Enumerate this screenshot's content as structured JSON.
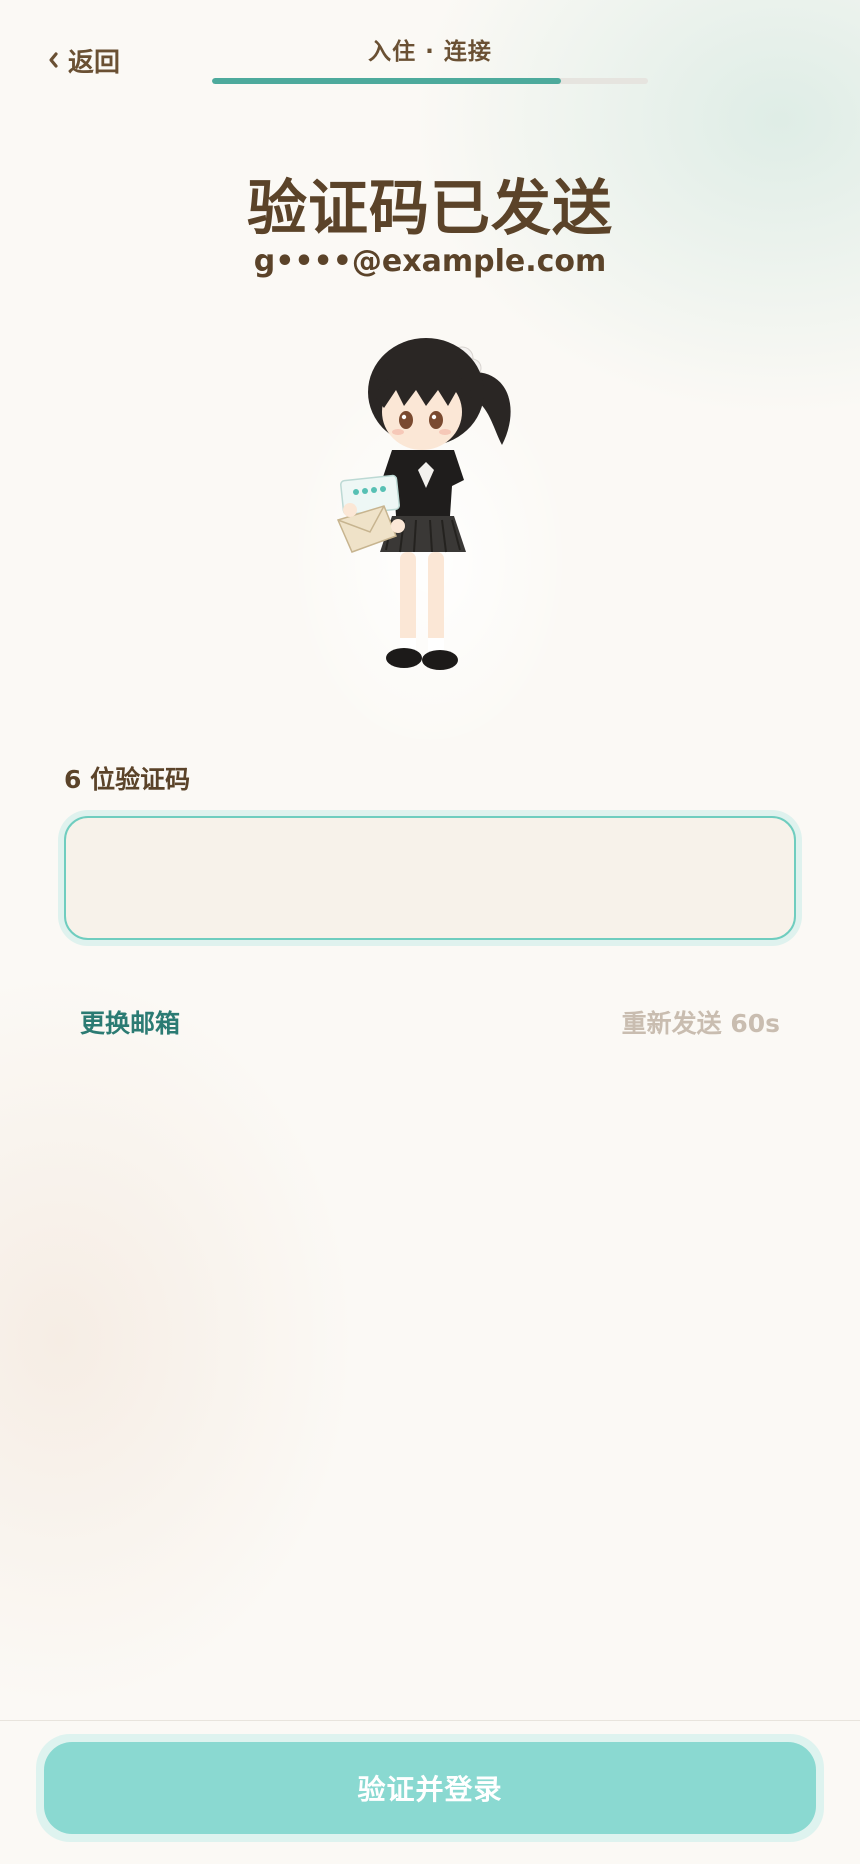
{
  "header": {
    "back_label": "返回",
    "step_title": "入住 · 连接",
    "progress_fraction": 0.8
  },
  "headline": "验证码已发送",
  "email": "g••••@example.com",
  "code_field": {
    "label": "6 位验证码",
    "value": "",
    "placeholder": ""
  },
  "actions": {
    "change_email": "更换邮箱",
    "resend": "重新发送 60s"
  },
  "submit_label": "验证并登录",
  "colors": {
    "accent": "#4daa9c",
    "brown_text": "#5b4329",
    "link_teal": "#2b7b73",
    "disabled_text": "#c9bdb0",
    "button_disabled": "#8ad9d1"
  }
}
